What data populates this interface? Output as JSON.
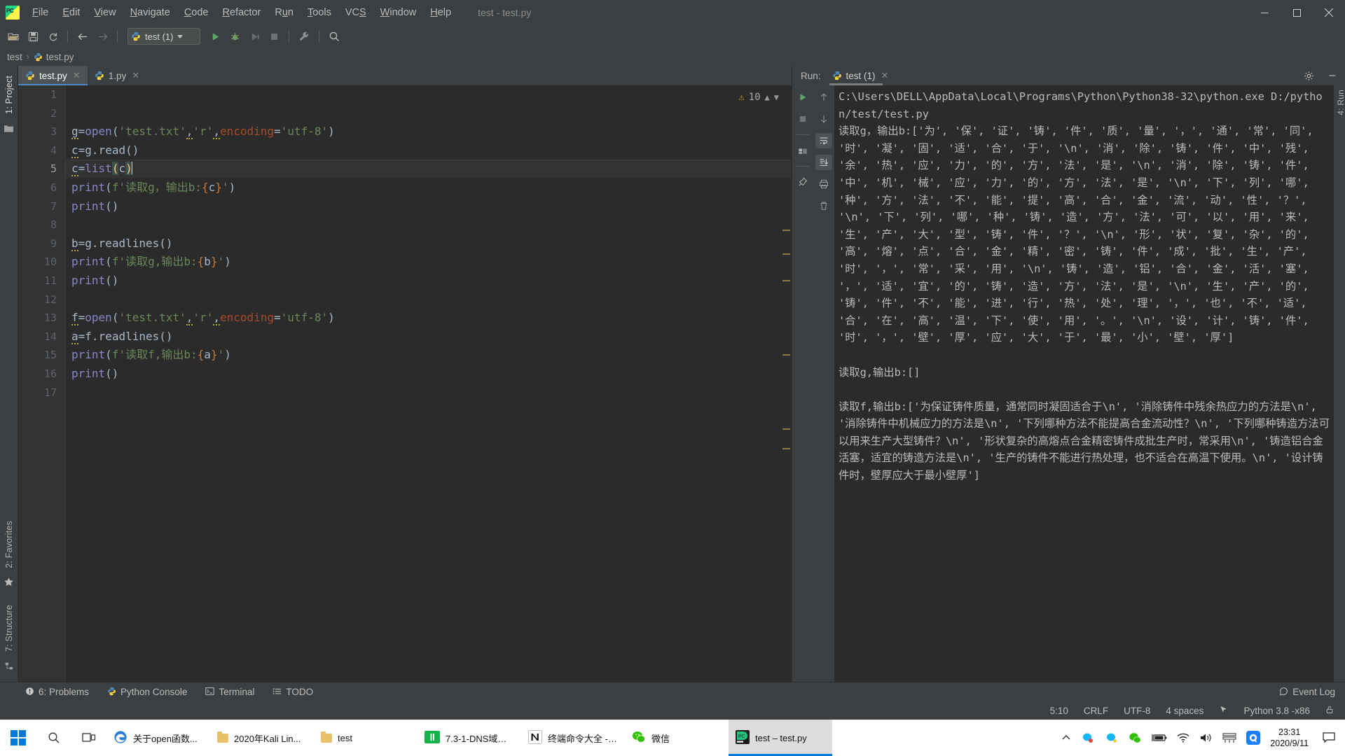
{
  "window": {
    "title": "test - test.py",
    "app_icon": "pycharm-logo"
  },
  "menubar": {
    "items": [
      "File",
      "Edit",
      "View",
      "Navigate",
      "Code",
      "Refactor",
      "Run",
      "Tools",
      "VCS",
      "Window",
      "Help"
    ]
  },
  "toolbar": {
    "open_label": "open-project",
    "save_label": "save-all",
    "sync_label": "sync",
    "back_label": "back",
    "forward_label": "forward",
    "run_config_name": "test (1)",
    "run_label": "Run",
    "debug_label": "Debug",
    "coverage_label": "Run with Coverage",
    "stop_label": "Stop",
    "settings_label": "Settings",
    "search_label": "Search Everywhere"
  },
  "breadcrumb": {
    "project": "test",
    "file": "test.py",
    "separator": "›"
  },
  "left_rail": {
    "project_tab": "1: Project",
    "favorites_tab": "2: Favorites",
    "structure_tab": "7: Structure"
  },
  "editor": {
    "tabs": [
      {
        "name": "test.py",
        "active": true
      },
      {
        "name": "1.py",
        "active": false
      }
    ],
    "inspection": {
      "count": "10",
      "up": "⌃",
      "down": "⌄"
    },
    "current_line": 5,
    "lines": [
      {
        "n": 1,
        "tokens": []
      },
      {
        "n": 2,
        "tokens": []
      },
      {
        "n": 3,
        "tokens": [
          {
            "t": "g",
            "c": "var",
            "sq": true
          },
          {
            "t": "=",
            "c": "op"
          },
          {
            "t": "open",
            "c": "fn"
          },
          {
            "t": "(",
            "c": "brace"
          },
          {
            "t": "'test.txt'",
            "c": "str"
          },
          {
            "t": ",",
            "c": "op",
            "sq": true
          },
          {
            "t": "'r'",
            "c": "str"
          },
          {
            "t": ",",
            "c": "op",
            "sq": true
          },
          {
            "t": "encoding",
            "c": "kwarg"
          },
          {
            "t": "=",
            "c": "op"
          },
          {
            "t": "'utf-8'",
            "c": "str"
          },
          {
            "t": ")",
            "c": "brace"
          }
        ]
      },
      {
        "n": 4,
        "tokens": [
          {
            "t": "c",
            "c": "var",
            "sq": true
          },
          {
            "t": "=",
            "c": "op"
          },
          {
            "t": "g",
            "c": "var"
          },
          {
            "t": ".",
            "c": "op"
          },
          {
            "t": "read",
            "c": "var"
          },
          {
            "t": "()",
            "c": "brace"
          }
        ]
      },
      {
        "n": 5,
        "tokens": [
          {
            "t": "c",
            "c": "var",
            "sq": true
          },
          {
            "t": "=",
            "c": "op"
          },
          {
            "t": "list",
            "c": "fn"
          },
          {
            "t": "(",
            "c": "selparen"
          },
          {
            "t": "c",
            "c": "var"
          },
          {
            "t": ")",
            "c": "selparen"
          }
        ]
      },
      {
        "n": 6,
        "tokens": [
          {
            "t": "print",
            "c": "fn"
          },
          {
            "t": "(",
            "c": "brace"
          },
          {
            "t": "f",
            "c": "str"
          },
          {
            "t": "'读取g，输出b:",
            "c": "str"
          },
          {
            "t": "{",
            "c": "fbrace"
          },
          {
            "t": "c",
            "c": "var"
          },
          {
            "t": "}",
            "c": "fbrace"
          },
          {
            "t": "'",
            "c": "str"
          },
          {
            "t": ")",
            "c": "brace"
          }
        ]
      },
      {
        "n": 7,
        "tokens": [
          {
            "t": "print",
            "c": "fn"
          },
          {
            "t": "()",
            "c": "brace"
          }
        ]
      },
      {
        "n": 8,
        "tokens": []
      },
      {
        "n": 9,
        "tokens": [
          {
            "t": "b",
            "c": "var",
            "sq": true
          },
          {
            "t": "=",
            "c": "op"
          },
          {
            "t": "g",
            "c": "var"
          },
          {
            "t": ".",
            "c": "op"
          },
          {
            "t": "readlines",
            "c": "var"
          },
          {
            "t": "()",
            "c": "brace"
          }
        ]
      },
      {
        "n": 10,
        "tokens": [
          {
            "t": "print",
            "c": "fn"
          },
          {
            "t": "(",
            "c": "brace"
          },
          {
            "t": "f",
            "c": "str"
          },
          {
            "t": "'读取g,输出b:",
            "c": "str"
          },
          {
            "t": "{",
            "c": "fbrace"
          },
          {
            "t": "b",
            "c": "var"
          },
          {
            "t": "}",
            "c": "fbrace"
          },
          {
            "t": "'",
            "c": "str"
          },
          {
            "t": ")",
            "c": "brace"
          }
        ]
      },
      {
        "n": 11,
        "tokens": [
          {
            "t": "print",
            "c": "fn"
          },
          {
            "t": "()",
            "c": "brace"
          }
        ]
      },
      {
        "n": 12,
        "tokens": []
      },
      {
        "n": 13,
        "tokens": [
          {
            "t": "f",
            "c": "var",
            "sq": true
          },
          {
            "t": "=",
            "c": "op"
          },
          {
            "t": "open",
            "c": "fn"
          },
          {
            "t": "(",
            "c": "brace"
          },
          {
            "t": "'test.txt'",
            "c": "str"
          },
          {
            "t": ",",
            "c": "op",
            "sq": true
          },
          {
            "t": "'r'",
            "c": "str"
          },
          {
            "t": ",",
            "c": "op",
            "sq": true
          },
          {
            "t": "encoding",
            "c": "kwarg"
          },
          {
            "t": "=",
            "c": "op"
          },
          {
            "t": "'utf-8'",
            "c": "str"
          },
          {
            "t": ")",
            "c": "brace"
          }
        ]
      },
      {
        "n": 14,
        "tokens": [
          {
            "t": "a",
            "c": "var",
            "sq": true
          },
          {
            "t": "=",
            "c": "op"
          },
          {
            "t": "f",
            "c": "var"
          },
          {
            "t": ".",
            "c": "op"
          },
          {
            "t": "readlines",
            "c": "var"
          },
          {
            "t": "()",
            "c": "brace"
          }
        ]
      },
      {
        "n": 15,
        "tokens": [
          {
            "t": "print",
            "c": "fn"
          },
          {
            "t": "(",
            "c": "brace"
          },
          {
            "t": "f",
            "c": "str"
          },
          {
            "t": "'读取f,输出b:",
            "c": "str"
          },
          {
            "t": "{",
            "c": "fbrace"
          },
          {
            "t": "a",
            "c": "var"
          },
          {
            "t": "}",
            "c": "fbrace"
          },
          {
            "t": "'",
            "c": "str"
          },
          {
            "t": ")",
            "c": "brace"
          }
        ]
      },
      {
        "n": 16,
        "tokens": [
          {
            "t": "print",
            "c": "fn"
          },
          {
            "t": "()",
            "c": "brace"
          }
        ]
      },
      {
        "n": 17,
        "tokens": []
      }
    ]
  },
  "run_panel": {
    "run_label": "Run:",
    "tab_name": "test (1)",
    "tab_close": "×",
    "settings_icon": "gear-icon",
    "minimize_icon": "minimize-icon",
    "side_tab": "4: Run",
    "toolbar_icons": [
      "rerun",
      "stop",
      "layout",
      "print",
      "delete"
    ],
    "console_lines": [
      "C:\\Users\\DELL\\AppData\\Local\\Programs\\Python\\Python38-32\\python.exe D:/python/test/test.py",
      "读取g，输出b:['为', '保', '证', '铸', '件', '质', '量', '，', '通', '常', '同', '时', '凝', '固', '适', '合', '于', '\\n', '消', '除', '铸', '件', '中', '残', '余', '热', '应', '力', '的', '方', '法', '是', '\\n', '消', '除', '铸', '件', '中', '机', '械', '应', '力', '的', '方', '法', '是', '\\n', '下', '列', '哪', '种', '方', '法', '不', '能', '提', '高', '合', '金', '流', '动', '性', '？', '\\n', '下', '列', '哪', '种', '铸', '造', '方', '法', '可', '以', '用', '来', '生', '产', '大', '型', '铸', '件', '？', '\\n', '形', '状', '复', '杂', '的', '高', '熔', '点', '合', '金', '精', '密', '铸', '件', '成', '批', '生', '产', '时', '，', '常', '采', '用', '\\n', '铸', '造', '铝', '合', '金', '活', '塞', '，', '适', '宜', '的', '铸', '造', '方', '法', '是', '\\n', '生', '产', '的', '铸', '件', '不', '能', '进', '行', '热', '处', '理', '，', '也', '不', '适', '合', '在', '高', '温', '下', '使', '用', '。', '\\n', '设', '计', '铸', '件', '时', '，', '壁', '厚', '应', '大', '于', '最', '小', '壁', '厚']",
      "",
      "读取g,输出b:[]",
      "",
      "读取f,输出b:['为保证铸件质量，通常同时凝固适合于\\n', '消除铸件中残余热应力的方法是\\n', '消除铸件中机械应力的方法是\\n', '下列哪种方法不能提高合金流动性？\\n', '下列哪种铸造方法可以用来生产大型铸件？\\n', '形状复杂的高熔点合金精密铸件成批生产时，常采用\\n', '铸造铝合金活塞，适宜的铸造方法是\\n', '生产的铸件不能进行热处理，也不适合在高温下使用。\\n', '设计铸件时，壁厚应大于最小壁厚']"
    ]
  },
  "bottom_bar": {
    "items": [
      {
        "label": "6: Problems",
        "icon": "problems-icon"
      },
      {
        "label": "Python Console",
        "icon": "python-icon"
      },
      {
        "label": "Terminal",
        "icon": "terminal-icon"
      },
      {
        "label": "TODO",
        "icon": "todo-icon"
      }
    ],
    "event_log": "Event Log"
  },
  "status_bar": {
    "caret_position": "5:10",
    "line_separator": "CRLF",
    "encoding": "UTF-8",
    "indent": "4 spaces",
    "interpreter": "Python 3.8 -x86",
    "lock_icon": "lock-icon",
    "git_icon": "git-branch-icon"
  },
  "taskbar": {
    "start": "start-button",
    "search": "search-icon",
    "task_view": "task-view-icon",
    "apps": [
      {
        "label": "关于open函数...",
        "icon": "edge-icon",
        "active": false
      },
      {
        "label": "2020年Kali Lin...",
        "icon": "folder-icon",
        "active": false
      },
      {
        "label": "test",
        "icon": "folder-icon",
        "active": false
      },
      {
        "label": "7.3-1-DNS域名...",
        "icon": "video-icon",
        "active": false
      },
      {
        "label": "终端命令大全 - ...",
        "icon": "notion-icon",
        "active": false
      },
      {
        "label": "微信",
        "icon": "wechat-icon",
        "active": false
      },
      {
        "label": "test – test.py",
        "icon": "pycharm-icon",
        "active": true
      }
    ],
    "tray": {
      "expand": "chevron-up-icon",
      "icons": [
        "qq-icon",
        "qq2-icon",
        "wechat-icon",
        "battery-icon",
        "wifi-icon",
        "volume-icon",
        "ime-icon",
        "qq-browser-icon"
      ],
      "time": "23:31",
      "date": "2020/9/11",
      "notifications": "notification-icon"
    }
  }
}
